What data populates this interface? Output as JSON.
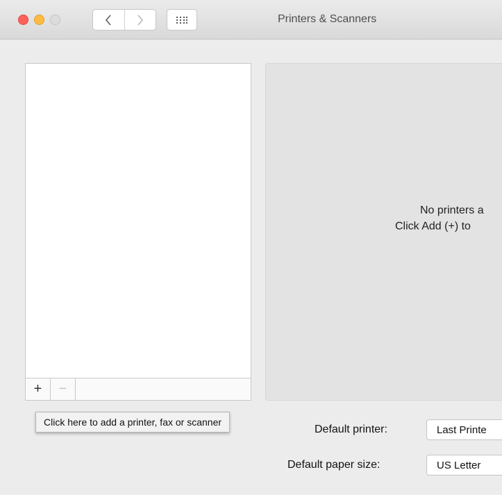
{
  "window": {
    "title": "Printers & Scanners"
  },
  "titlebar": {
    "back_icon": "chevron-left-icon",
    "forward_icon": "chevron-right-icon",
    "show_all_icon": "grid-icon"
  },
  "printer_list": {
    "items": [],
    "add_label": "+",
    "remove_label": "−"
  },
  "detail": {
    "empty_line1": "No printers a",
    "empty_line2": "Click Add (+) to"
  },
  "tooltip": {
    "text": "Click here to add a printer, fax or scanner"
  },
  "defaults": {
    "printer_label": "Default printer:",
    "printer_value": "Last Printe",
    "paper_label": "Default paper size:",
    "paper_value": "US Letter"
  },
  "colors": {
    "close": "#fc605b",
    "minimize": "#fdbc40",
    "zoom": "#dcdcdc"
  }
}
